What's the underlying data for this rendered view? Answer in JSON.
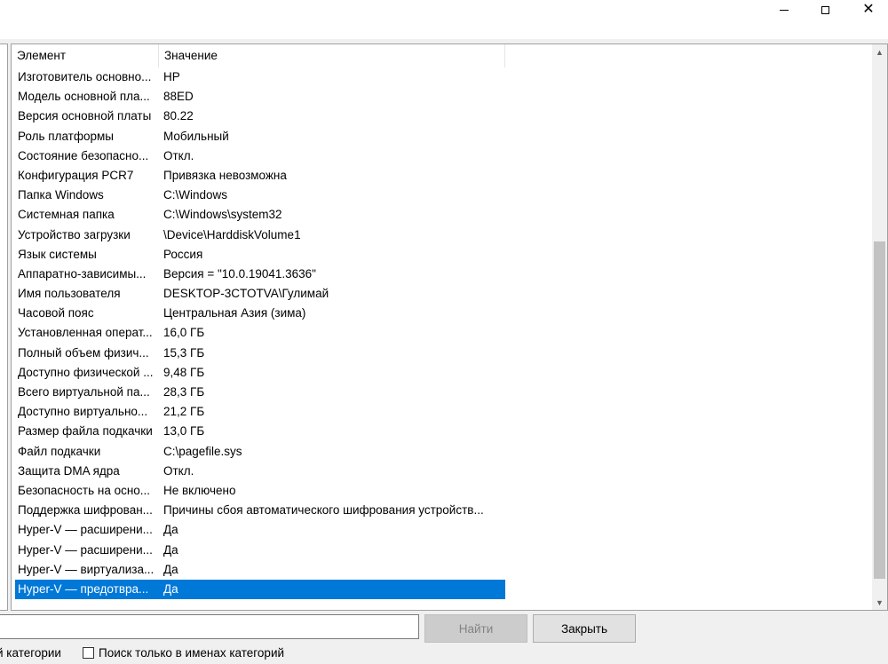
{
  "window": {
    "minimize_glyph": "",
    "maximize_glyph": "",
    "close_glyph": "✕"
  },
  "listview": {
    "columns": [
      "Элемент",
      "Значение"
    ],
    "rows": [
      {
        "item": "Изготовитель основно...",
        "value": "HP"
      },
      {
        "item": "Модель основной пла...",
        "value": "88ED"
      },
      {
        "item": "Версия основной платы",
        "value": "80.22"
      },
      {
        "item": "Роль платформы",
        "value": "Мобильный"
      },
      {
        "item": "Состояние безопасно...",
        "value": "Откл."
      },
      {
        "item": "Конфигурация PCR7",
        "value": "Привязка невозможна"
      },
      {
        "item": "Папка Windows",
        "value": "C:\\Windows"
      },
      {
        "item": "Системная папка",
        "value": "C:\\Windows\\system32"
      },
      {
        "item": "Устройство загрузки",
        "value": "\\Device\\HarddiskVolume1"
      },
      {
        "item": "Язык системы",
        "value": "Россия"
      },
      {
        "item": "Аппаратно-зависимы...",
        "value": "Версия = \"10.0.19041.3636\""
      },
      {
        "item": "Имя пользователя",
        "value": "DESKTOP-3CTOTVA\\Гулимай"
      },
      {
        "item": "Часовой пояс",
        "value": "Центральная Азия (зима)"
      },
      {
        "item": "Установленная операт...",
        "value": "16,0 ГБ"
      },
      {
        "item": "Полный объем физич...",
        "value": "15,3 ГБ"
      },
      {
        "item": "Доступно физической ...",
        "value": "9,48 ГБ"
      },
      {
        "item": "Всего виртуальной па...",
        "value": "28,3 ГБ"
      },
      {
        "item": "Доступно виртуально...",
        "value": "21,2 ГБ"
      },
      {
        "item": "Размер файла подкачки",
        "value": "13,0 ГБ"
      },
      {
        "item": "Файл подкачки",
        "value": "C:\\pagefile.sys"
      },
      {
        "item": "Защита DMA ядра",
        "value": "Откл."
      },
      {
        "item": "Безопасность на осно...",
        "value": "Не включено"
      },
      {
        "item": "Поддержка шифрован...",
        "value": "Причины сбоя автоматического шифрования устройств..."
      },
      {
        "item": "Hyper-V — расширени...",
        "value": "Да"
      },
      {
        "item": "Hyper-V — расширени...",
        "value": "Да"
      },
      {
        "item": "Hyper-V — виртуализа...",
        "value": "Да"
      },
      {
        "item": "Hyper-V — предотвра...",
        "value": "Да",
        "selected": true
      }
    ],
    "scrollbar": {
      "up_arrow": "▲",
      "down_arrow": "▼",
      "thumb_start": 0.34,
      "thumb_end": 0.97
    }
  },
  "footer": {
    "search_value": "",
    "find_button": "Найти",
    "close_button": "Закрыть",
    "left_checkbox_label": "й категории",
    "names_only_checkbox_label": "Поиск только в именах категорий"
  },
  "colors": {
    "selection": "#0078d7",
    "selection_text": "#ffffff",
    "disabled_button": "#cccccc"
  }
}
